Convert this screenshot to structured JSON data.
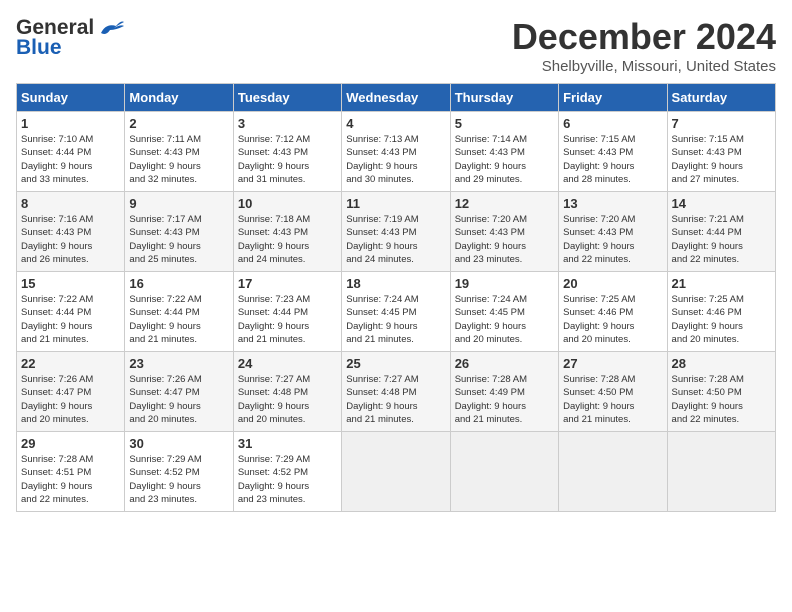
{
  "header": {
    "logo_line1": "General",
    "logo_line2": "Blue",
    "month": "December 2024",
    "location": "Shelbyville, Missouri, United States"
  },
  "weekdays": [
    "Sunday",
    "Monday",
    "Tuesday",
    "Wednesday",
    "Thursday",
    "Friday",
    "Saturday"
  ],
  "weeks": [
    [
      {
        "day": "1",
        "info": "Sunrise: 7:10 AM\nSunset: 4:44 PM\nDaylight: 9 hours\nand 33 minutes."
      },
      {
        "day": "2",
        "info": "Sunrise: 7:11 AM\nSunset: 4:43 PM\nDaylight: 9 hours\nand 32 minutes."
      },
      {
        "day": "3",
        "info": "Sunrise: 7:12 AM\nSunset: 4:43 PM\nDaylight: 9 hours\nand 31 minutes."
      },
      {
        "day": "4",
        "info": "Sunrise: 7:13 AM\nSunset: 4:43 PM\nDaylight: 9 hours\nand 30 minutes."
      },
      {
        "day": "5",
        "info": "Sunrise: 7:14 AM\nSunset: 4:43 PM\nDaylight: 9 hours\nand 29 minutes."
      },
      {
        "day": "6",
        "info": "Sunrise: 7:15 AM\nSunset: 4:43 PM\nDaylight: 9 hours\nand 28 minutes."
      },
      {
        "day": "7",
        "info": "Sunrise: 7:15 AM\nSunset: 4:43 PM\nDaylight: 9 hours\nand 27 minutes."
      }
    ],
    [
      {
        "day": "8",
        "info": "Sunrise: 7:16 AM\nSunset: 4:43 PM\nDaylight: 9 hours\nand 26 minutes."
      },
      {
        "day": "9",
        "info": "Sunrise: 7:17 AM\nSunset: 4:43 PM\nDaylight: 9 hours\nand 25 minutes."
      },
      {
        "day": "10",
        "info": "Sunrise: 7:18 AM\nSunset: 4:43 PM\nDaylight: 9 hours\nand 24 minutes."
      },
      {
        "day": "11",
        "info": "Sunrise: 7:19 AM\nSunset: 4:43 PM\nDaylight: 9 hours\nand 24 minutes."
      },
      {
        "day": "12",
        "info": "Sunrise: 7:20 AM\nSunset: 4:43 PM\nDaylight: 9 hours\nand 23 minutes."
      },
      {
        "day": "13",
        "info": "Sunrise: 7:20 AM\nSunset: 4:43 PM\nDaylight: 9 hours\nand 22 minutes."
      },
      {
        "day": "14",
        "info": "Sunrise: 7:21 AM\nSunset: 4:44 PM\nDaylight: 9 hours\nand 22 minutes."
      }
    ],
    [
      {
        "day": "15",
        "info": "Sunrise: 7:22 AM\nSunset: 4:44 PM\nDaylight: 9 hours\nand 21 minutes."
      },
      {
        "day": "16",
        "info": "Sunrise: 7:22 AM\nSunset: 4:44 PM\nDaylight: 9 hours\nand 21 minutes."
      },
      {
        "day": "17",
        "info": "Sunrise: 7:23 AM\nSunset: 4:44 PM\nDaylight: 9 hours\nand 21 minutes."
      },
      {
        "day": "18",
        "info": "Sunrise: 7:24 AM\nSunset: 4:45 PM\nDaylight: 9 hours\nand 21 minutes."
      },
      {
        "day": "19",
        "info": "Sunrise: 7:24 AM\nSunset: 4:45 PM\nDaylight: 9 hours\nand 20 minutes."
      },
      {
        "day": "20",
        "info": "Sunrise: 7:25 AM\nSunset: 4:46 PM\nDaylight: 9 hours\nand 20 minutes."
      },
      {
        "day": "21",
        "info": "Sunrise: 7:25 AM\nSunset: 4:46 PM\nDaylight: 9 hours\nand 20 minutes."
      }
    ],
    [
      {
        "day": "22",
        "info": "Sunrise: 7:26 AM\nSunset: 4:47 PM\nDaylight: 9 hours\nand 20 minutes."
      },
      {
        "day": "23",
        "info": "Sunrise: 7:26 AM\nSunset: 4:47 PM\nDaylight: 9 hours\nand 20 minutes."
      },
      {
        "day": "24",
        "info": "Sunrise: 7:27 AM\nSunset: 4:48 PM\nDaylight: 9 hours\nand 20 minutes."
      },
      {
        "day": "25",
        "info": "Sunrise: 7:27 AM\nSunset: 4:48 PM\nDaylight: 9 hours\nand 21 minutes."
      },
      {
        "day": "26",
        "info": "Sunrise: 7:28 AM\nSunset: 4:49 PM\nDaylight: 9 hours\nand 21 minutes."
      },
      {
        "day": "27",
        "info": "Sunrise: 7:28 AM\nSunset: 4:50 PM\nDaylight: 9 hours\nand 21 minutes."
      },
      {
        "day": "28",
        "info": "Sunrise: 7:28 AM\nSunset: 4:50 PM\nDaylight: 9 hours\nand 22 minutes."
      }
    ],
    [
      {
        "day": "29",
        "info": "Sunrise: 7:28 AM\nSunset: 4:51 PM\nDaylight: 9 hours\nand 22 minutes."
      },
      {
        "day": "30",
        "info": "Sunrise: 7:29 AM\nSunset: 4:52 PM\nDaylight: 9 hours\nand 23 minutes."
      },
      {
        "day": "31",
        "info": "Sunrise: 7:29 AM\nSunset: 4:52 PM\nDaylight: 9 hours\nand 23 minutes."
      },
      {
        "day": "",
        "info": ""
      },
      {
        "day": "",
        "info": ""
      },
      {
        "day": "",
        "info": ""
      },
      {
        "day": "",
        "info": ""
      }
    ]
  ]
}
